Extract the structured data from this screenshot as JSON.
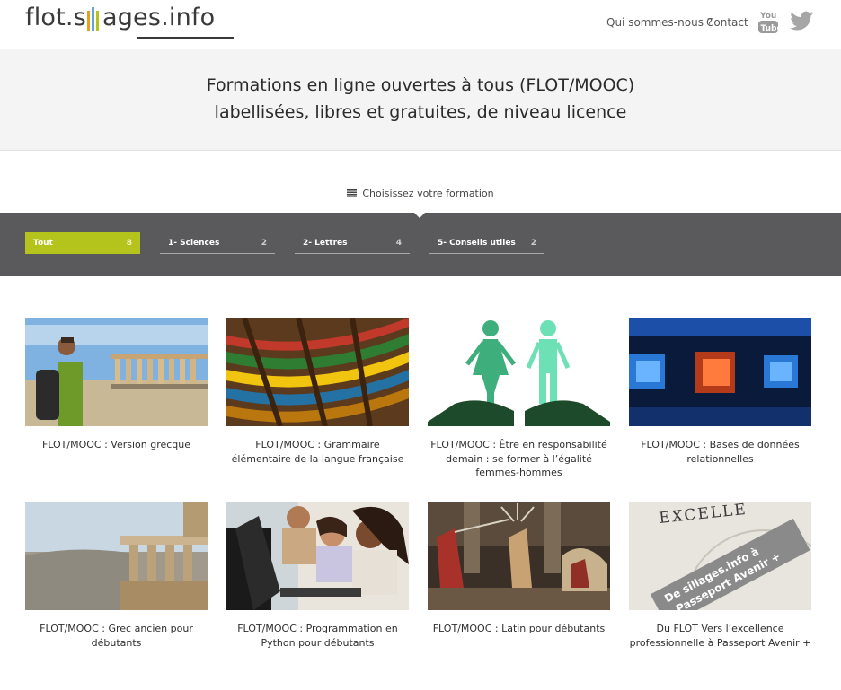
{
  "header": {
    "logo_prefix": "flot.s",
    "logo_suffix": "ages.info",
    "nav": [
      "Qui sommes-nous ?",
      "Contact"
    ],
    "social_icons": [
      "youtube-icon",
      "twitter-icon"
    ]
  },
  "hero": {
    "line1": "Formations en ligne ouvertes à tous (FLOT/MOOC)",
    "line2": "labellisées, libres et gratuites, de niveau licence"
  },
  "chooser": {
    "label": "Choisissez votre formation",
    "icon": "menu-icon"
  },
  "filters": [
    {
      "label": "Tout",
      "count": "8",
      "active": true
    },
    {
      "label": "1- Sciences",
      "count": "2",
      "active": false
    },
    {
      "label": "2- Lettres",
      "count": "4",
      "active": false
    },
    {
      "label": "5- Conseils utiles",
      "count": "2",
      "active": false
    }
  ],
  "courses": [
    {
      "title": "FLOT/MOOC : Version grecque"
    },
    {
      "title": "FLOT/MOOC : Grammaire élémentaire de la langue française"
    },
    {
      "title": "FLOT/MOOC : Être en responsabilité demain : se former à l’égalité femmes-hommes"
    },
    {
      "title": "FLOT/MOOC : Bases de données relationnelles"
    },
    {
      "title": "FLOT/MOOC : Grec ancien pour débutants"
    },
    {
      "title": "FLOT/MOOC : Programmation en Python pour débutants"
    },
    {
      "title": "FLOT/MOOC : Latin pour débutants"
    },
    {
      "title": "Du FLOT Vers l’excellence professionnelle à Passeport Avenir +"
    }
  ],
  "image_texts": {
    "excellence_word": "EXCELLE",
    "banner_line1": "De sillages.info à",
    "banner_line2": "Passeport Avenir +"
  },
  "colors": {
    "accent": "#b5c41c",
    "band": "#5a5a5c"
  }
}
